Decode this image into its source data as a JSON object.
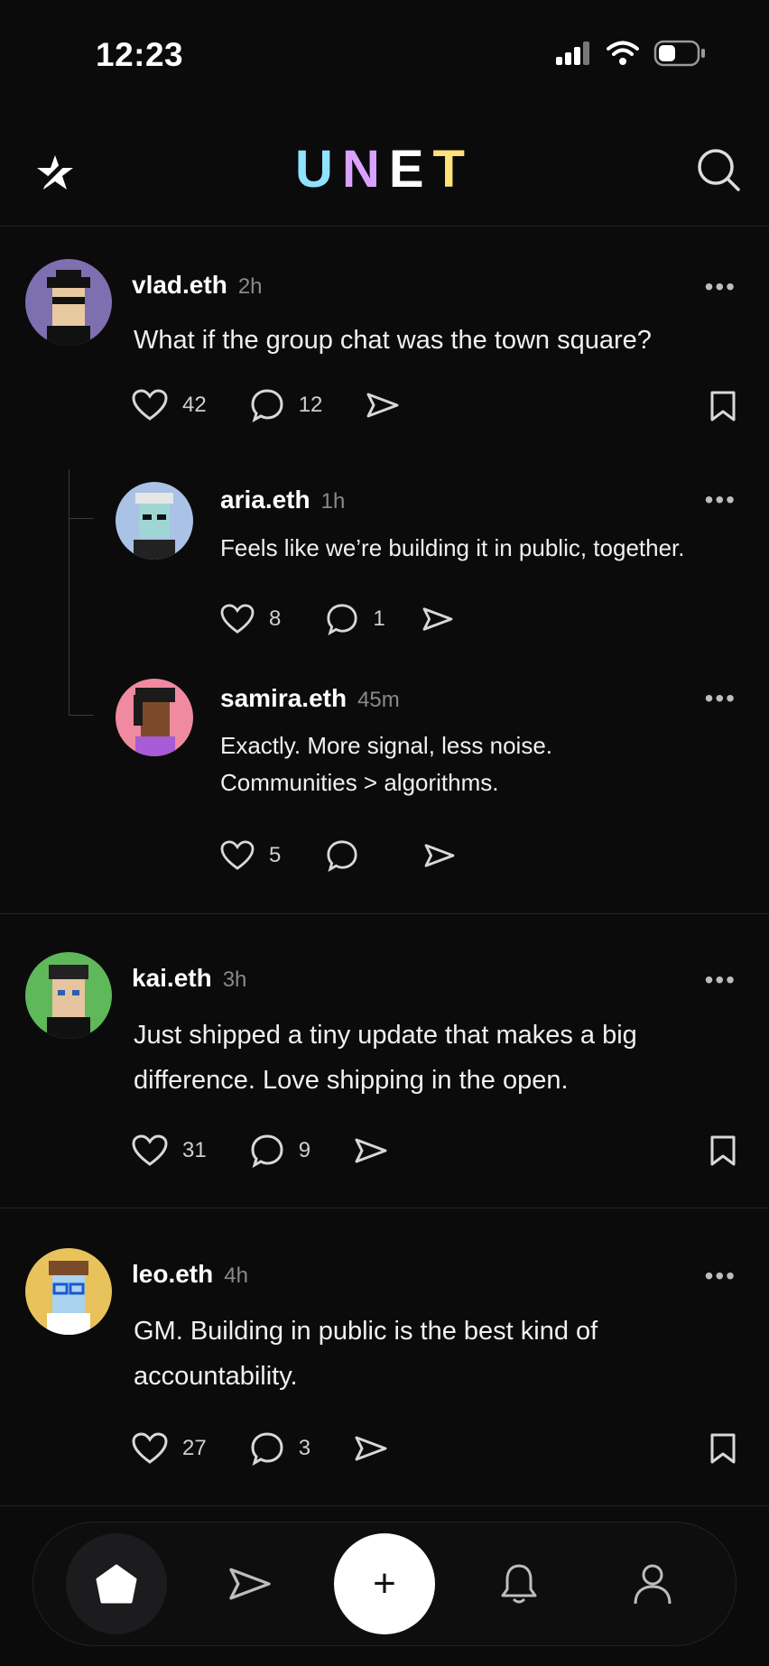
{
  "status_bar": {
    "time": "12:23"
  },
  "header": {
    "brand": [
      "U",
      "N",
      "E",
      "T"
    ],
    "brand_colors": [
      "#8fe3ff",
      "#d9a2ff",
      "#ffffff",
      "#ffe27a"
    ]
  },
  "posts": [
    {
      "user": "vlad.eth",
      "ago": "2h",
      "text": "What if the group chat was the town square?",
      "likes": "42",
      "comments": "12",
      "avatar_color": "#7e6fb0"
    },
    {
      "user": "kai.eth",
      "ago": "3h",
      "text_lines": [
        "Just shipped a tiny update that makes a big",
        "difference. Love shipping in the open."
      ],
      "likes": "31",
      "comments": "9",
      "avatar_color": "#5fb85a"
    },
    {
      "user": "leo.eth",
      "ago": "4h",
      "text_lines": [
        "GM. Building in public is the best kind of",
        "accountability."
      ],
      "likes": "27",
      "comments": "3",
      "avatar_color": "#e8c25a"
    }
  ],
  "replies": [
    {
      "user": "aria.eth",
      "ago": "1h",
      "text": "Feels like we’re building it in public, together.",
      "likes": "8",
      "comments": "1",
      "avatar_color": "#a9c2e6"
    },
    {
      "user": "samira.eth",
      "ago": "45m",
      "text_lines": [
        "Exactly. More signal, less noise.",
        "Communities > algorithms."
      ],
      "likes": "5",
      "avatar_color": "#f08aa0"
    }
  ],
  "more_label": "•••",
  "tabbar": {
    "compose_label": "+"
  }
}
